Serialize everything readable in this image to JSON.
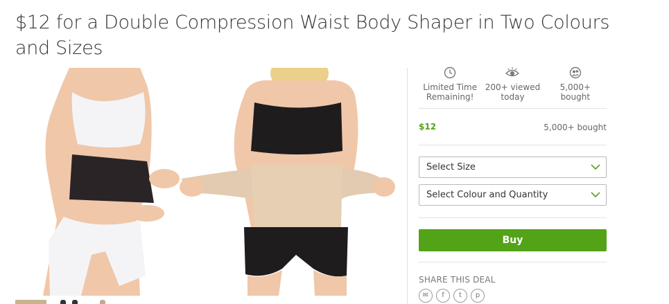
{
  "deal": {
    "title": "$12 for a Double Compression Waist Body Shaper in Two Colours and Sizes"
  },
  "stats": [
    {
      "icon": "clock-icon",
      "label_line1": "Limited Time",
      "label_line2": "Remaining!"
    },
    {
      "icon": "eye-icon",
      "label_line1": "200+ viewed",
      "label_line2": "today"
    },
    {
      "icon": "people-icon",
      "label_line1": "5,000+ bought",
      "label_line2": ""
    }
  ],
  "price": {
    "value": "$12",
    "bought": "5,000+ bought"
  },
  "options": {
    "size_placeholder": "Select Size",
    "colour_placeholder": "Select Colour and Quantity"
  },
  "buy": {
    "label": "Buy"
  },
  "share": {
    "title": "SHARE THIS DEAL",
    "icons": [
      "email-icon",
      "facebook-icon",
      "twitter-icon",
      "pinterest-icon"
    ]
  },
  "colors": {
    "accent_green": "#53a318",
    "text": "#333333",
    "muted": "#666666"
  }
}
